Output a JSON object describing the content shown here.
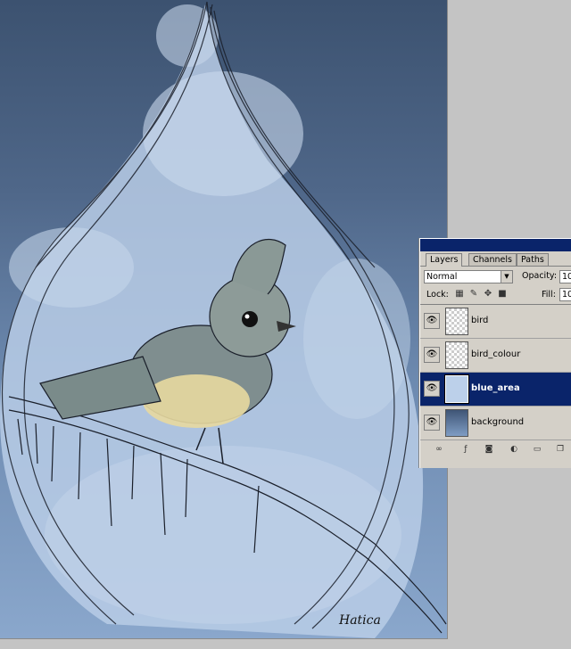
{
  "layers_panel": {
    "tabs": [
      "Layers",
      "Channels",
      "Paths"
    ],
    "active_tab": "Layers",
    "blend_mode": "Normal",
    "opacity_label": "Opacity:",
    "opacity_value": "10",
    "lock_label": "Lock:",
    "fill_label": "Fill:",
    "fill_value": "10",
    "layers": [
      {
        "name": "bird",
        "visible": true,
        "selected": false
      },
      {
        "name": "bird_colour",
        "visible": true,
        "selected": false
      },
      {
        "name": "blue_area",
        "visible": true,
        "selected": true
      },
      {
        "name": "background",
        "visible": true,
        "selected": false
      }
    ],
    "footer_icons": [
      "link-icon",
      "layer-style-icon",
      "mask-icon",
      "adjustment-icon",
      "group-folder-icon",
      "new-layer-icon"
    ]
  },
  "canvas": {
    "signature": "Hatica"
  },
  "colors": {
    "canvas_top": "#3c5270",
    "canvas_bottom": "#8aa7cc",
    "selection": "#0a246a",
    "panel_bg": "#d4d0c8"
  }
}
